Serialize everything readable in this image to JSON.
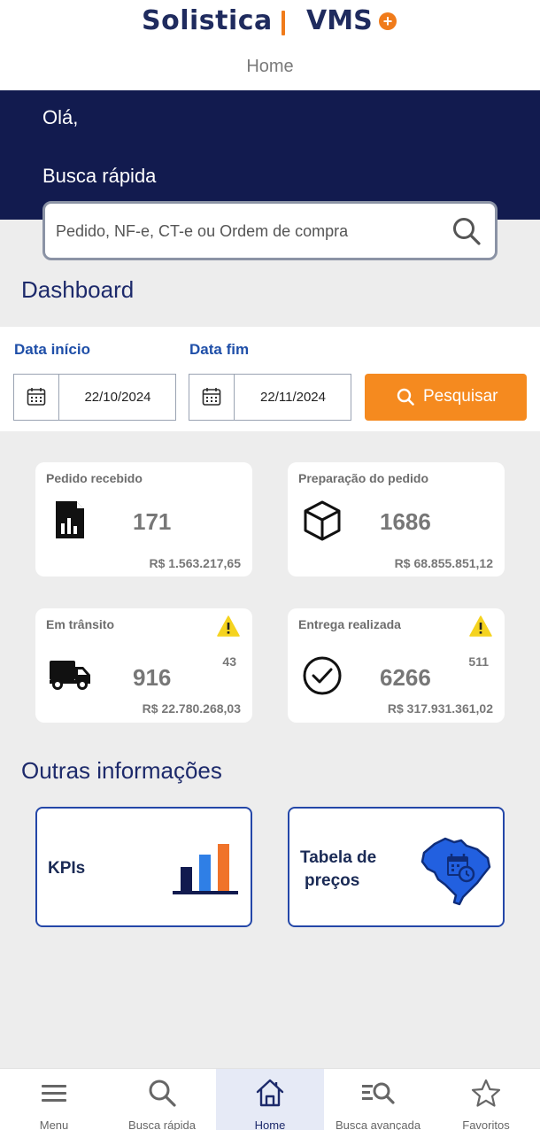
{
  "brand": {
    "name": "Solistica",
    "product": "VMS"
  },
  "header": {
    "title": "Home"
  },
  "hero": {
    "greeting": "Olá,",
    "quick_search_label": "Busca rápida"
  },
  "search": {
    "placeholder": "Pedido, NF-e, CT-e ou Ordem de compra",
    "value": ""
  },
  "dashboard": {
    "title": "Dashboard",
    "start_label": "Data início",
    "end_label": "Data fim",
    "start_date": "22/10/2024",
    "end_date": "22/11/2024",
    "search_button": "Pesquisar",
    "cards": [
      {
        "title": "Pedido recebido",
        "count": "171",
        "amount": "R$ 1.563.217,65",
        "icon": "document-chart-icon"
      },
      {
        "title": "Preparação do pedido",
        "count": "1686",
        "amount": "R$ 68.855.851,12",
        "icon": "box-icon"
      },
      {
        "title": "Em trânsito",
        "count": "916",
        "alert_count": "43",
        "amount": "R$ 22.780.268,03",
        "icon": "truck-icon"
      },
      {
        "title": "Entrega realizada",
        "count": "6266",
        "alert_count": "511",
        "amount": "R$ 317.931.361,02",
        "icon": "check-circle-icon"
      }
    ]
  },
  "other_info": {
    "title": "Outras informações",
    "items": [
      {
        "label": "KPIs",
        "icon": "bar-chart-icon"
      },
      {
        "label_line1": "Tabela de",
        "label_line2": "preços",
        "icon": "brazil-map-icon"
      }
    ]
  },
  "colors": {
    "navy": "#121b4f",
    "accent": "#f58a1f",
    "link": "#1f4fa8",
    "warning": "#f5d31f"
  },
  "bottom_nav": [
    {
      "label": "Menu",
      "icon": "menu-icon"
    },
    {
      "label": "Busca rápida",
      "icon": "search-icon"
    },
    {
      "label": "Home",
      "icon": "home-icon",
      "active": true
    },
    {
      "label": "Busca avançada",
      "icon": "advanced-search-icon"
    },
    {
      "label": "Favoritos",
      "icon": "star-icon"
    }
  ]
}
